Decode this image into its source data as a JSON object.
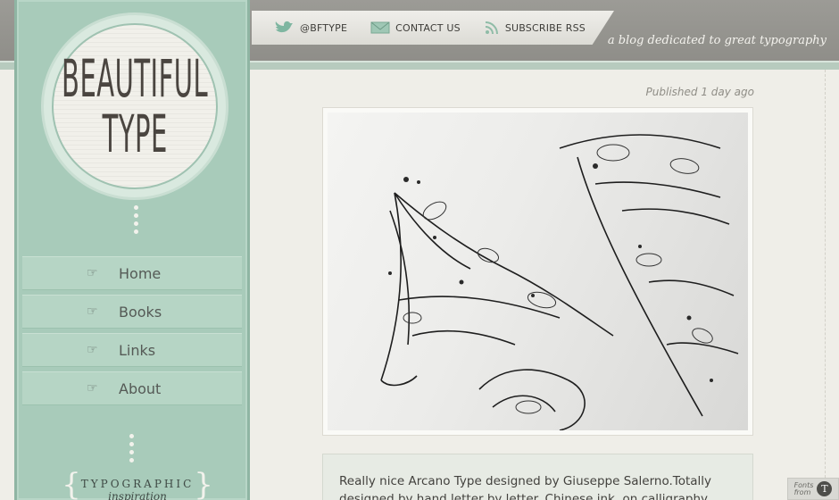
{
  "header": {
    "links": [
      {
        "label": "@BFTYPE",
        "icon": "twitter-bird-icon"
      },
      {
        "label": "CONTACT US",
        "icon": "envelope-icon"
      },
      {
        "label": "SUBSCRIBE RSS",
        "icon": "rss-icon"
      }
    ],
    "tagline": "a blog dedicated to great typography"
  },
  "logo": {
    "line1": "BEAUTIFUL",
    "line2": "TYPE"
  },
  "sidebar": {
    "menu": [
      {
        "label": "Home",
        "icon": "pointing-hand-icon"
      },
      {
        "label": "Books",
        "icon": "pointing-hand-icon"
      },
      {
        "label": "Links",
        "icon": "pointing-hand-icon"
      },
      {
        "label": "About",
        "icon": "pointing-hand-icon"
      }
    ],
    "inspiration_line1": "TYPOGRAPHIC",
    "inspiration_line2": "inspiration"
  },
  "post": {
    "published": "Published 1 day ago",
    "body": "Really nice Arcano Type designed by Giuseppe Salerno.Totally designed by hand letter by letter. Chinese ink, on calligraphy"
  },
  "badge": {
    "line1": "Fonts",
    "line2": "from"
  },
  "colors": {
    "sidebar_green": "#a8cbba",
    "background": "#efeee8",
    "top_bar": "#9c9b96"
  }
}
